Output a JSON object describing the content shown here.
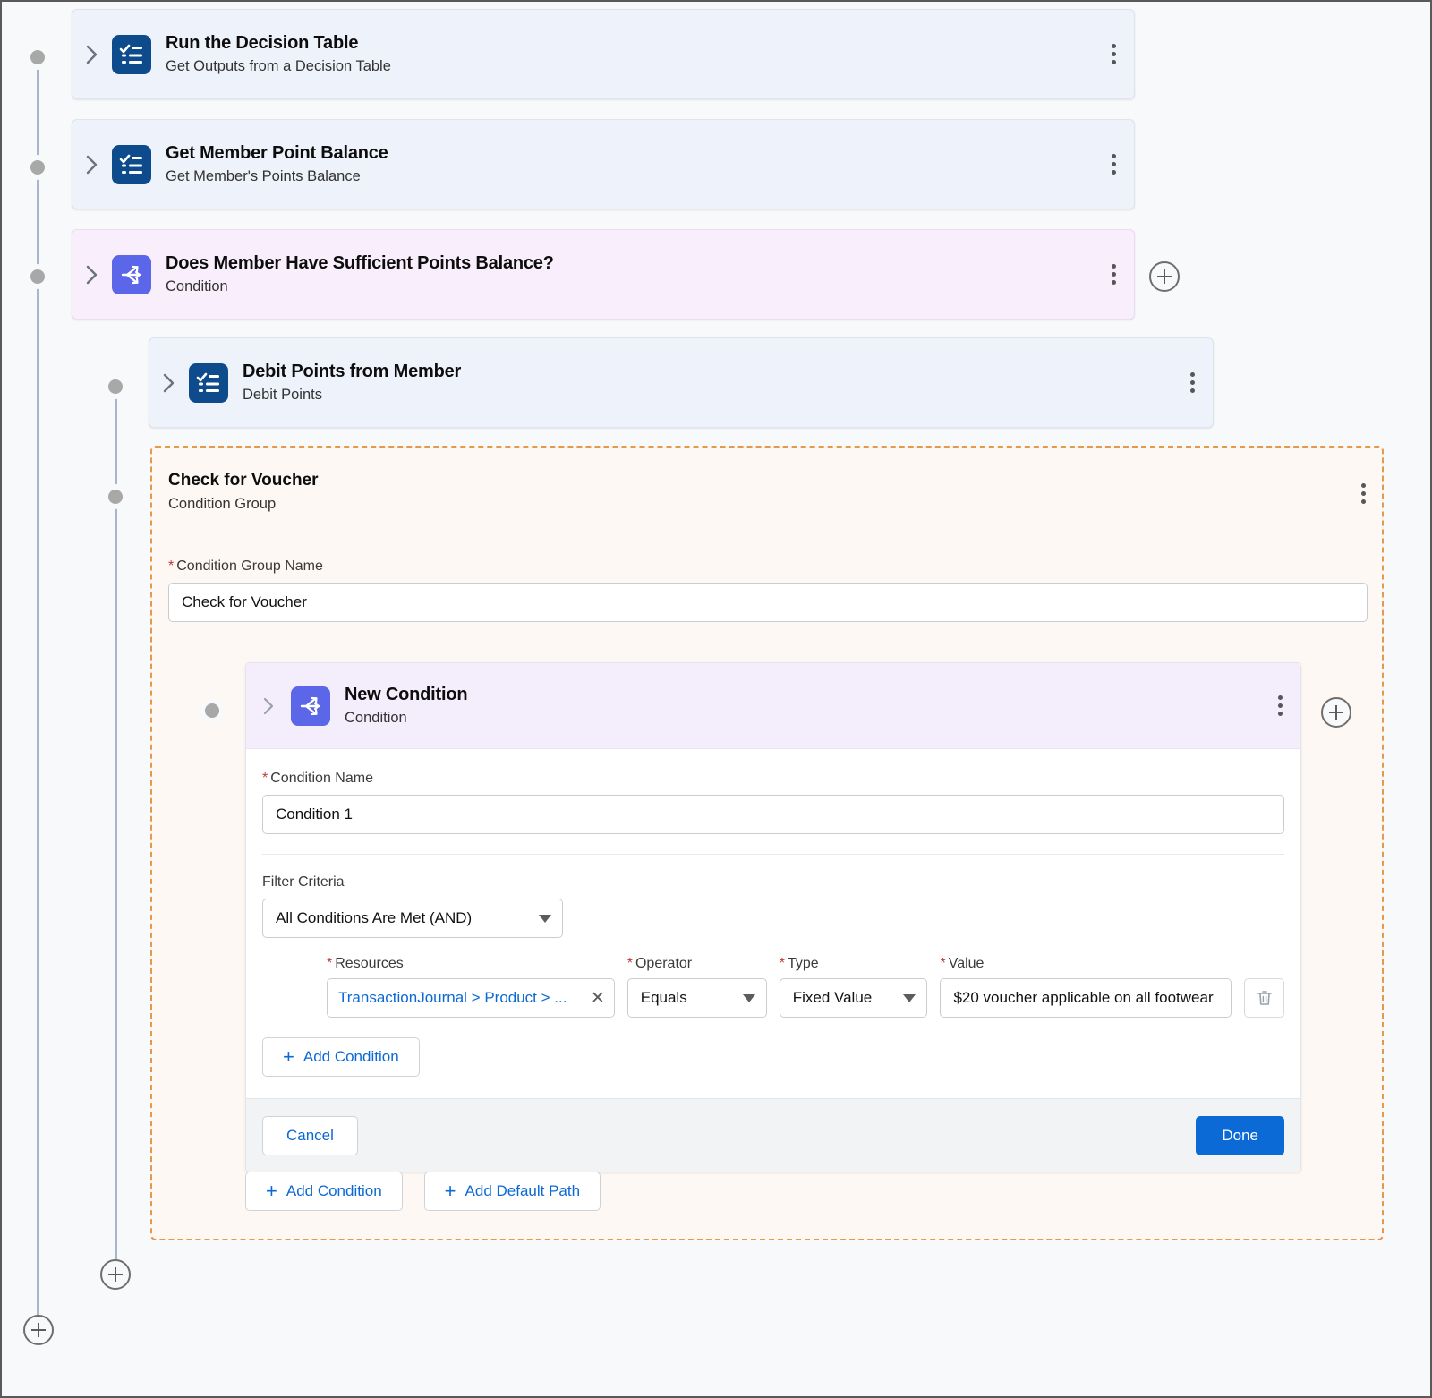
{
  "flow": {
    "steps": [
      {
        "title": "Run the Decision Table",
        "subtitle": "Get Outputs from a Decision Table",
        "icon": "decision-table-icon",
        "type": "action"
      },
      {
        "title": "Get Member Point Balance",
        "subtitle": "Get Member's Points Balance",
        "icon": "decision-table-icon",
        "type": "action"
      },
      {
        "title": "Does Member Have Sufficient Points Balance?",
        "subtitle": "Condition",
        "icon": "branch-icon",
        "type": "condition"
      },
      {
        "title": "Debit Points from Member",
        "subtitle": "Debit Points",
        "icon": "decision-table-icon",
        "type": "action"
      }
    ]
  },
  "group": {
    "title": "Check for Voucher",
    "subtitle": "Condition Group",
    "name_label": "Condition Group Name",
    "name_value": "Check for Voucher",
    "add_condition_label": "Add Condition",
    "add_default_path_label": "Add Default Path"
  },
  "condition": {
    "header_title": "New Condition",
    "header_subtitle": "Condition",
    "name_label": "Condition Name",
    "name_value": "Condition 1",
    "filter_criteria_label": "Filter Criteria",
    "filter_criteria_value": "All Conditions Are Met (AND)",
    "columns": {
      "resources": "Resources",
      "operator": "Operator",
      "type": "Type",
      "value": "Value"
    },
    "row": {
      "resource": "TransactionJournal > Product > ...",
      "operator": "Equals",
      "type": "Fixed Value",
      "value": "$20 voucher applicable on all footwear"
    },
    "add_condition_label": "Add Condition",
    "cancel_label": "Cancel",
    "done_label": "Done"
  },
  "colors": {
    "action_icon": "#0e4b8c",
    "condition_icon": "#5b66e8",
    "action_card_bg": "#eef2fb",
    "condition_card_bg": "#f9eefb",
    "group_border": "#e49a4c",
    "group_bg": "#fdf8f3",
    "primary_button": "#0b6ad6",
    "link": "#0b69d4",
    "required_star": "#c23934"
  }
}
